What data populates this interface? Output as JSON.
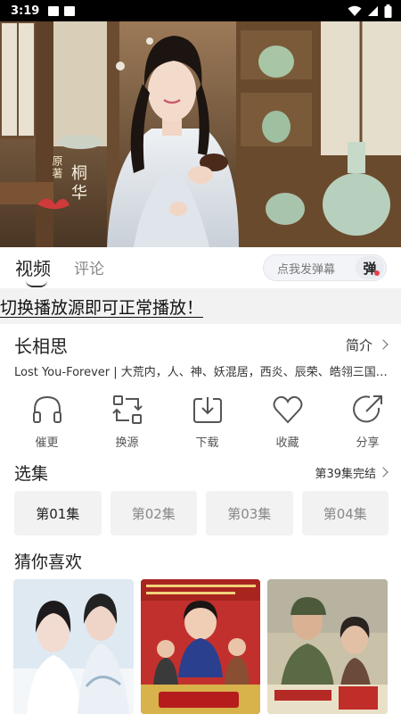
{
  "status_bar": {
    "time": "3:19"
  },
  "tabs": {
    "video": "视频",
    "comments": "评论"
  },
  "danmaku": {
    "placeholder": "点我发弹幕",
    "button": "弹"
  },
  "notice": "切换播放源即可正常播放！",
  "video_overlay": {
    "calligraphy_small": "原著",
    "calligraphy_big": "桐华"
  },
  "show": {
    "title": "长相思",
    "intro_link": "简介",
    "description": "Lost You-Forever | 大荒内，人、神、妖混居，西炎、辰荣、皓翎三国鼎立"
  },
  "actions": [
    {
      "label": "催更",
      "icon": "headphones-icon"
    },
    {
      "label": "换源",
      "icon": "switch-source-icon"
    },
    {
      "label": "下载",
      "icon": "download-icon"
    },
    {
      "label": "收藏",
      "icon": "heart-icon"
    },
    {
      "label": "分享",
      "icon": "share-icon"
    }
  ],
  "episodes": {
    "title": "选集",
    "status": "第39集完结",
    "items": [
      "第01集",
      "第02集",
      "第03集",
      "第04集"
    ],
    "selected": "第01集"
  },
  "recommend": {
    "title": "猜你喜欢"
  },
  "colors": {
    "accent_red": "#e6414b",
    "background": "#ffffff",
    "chip_bg": "#f2f2f2"
  }
}
